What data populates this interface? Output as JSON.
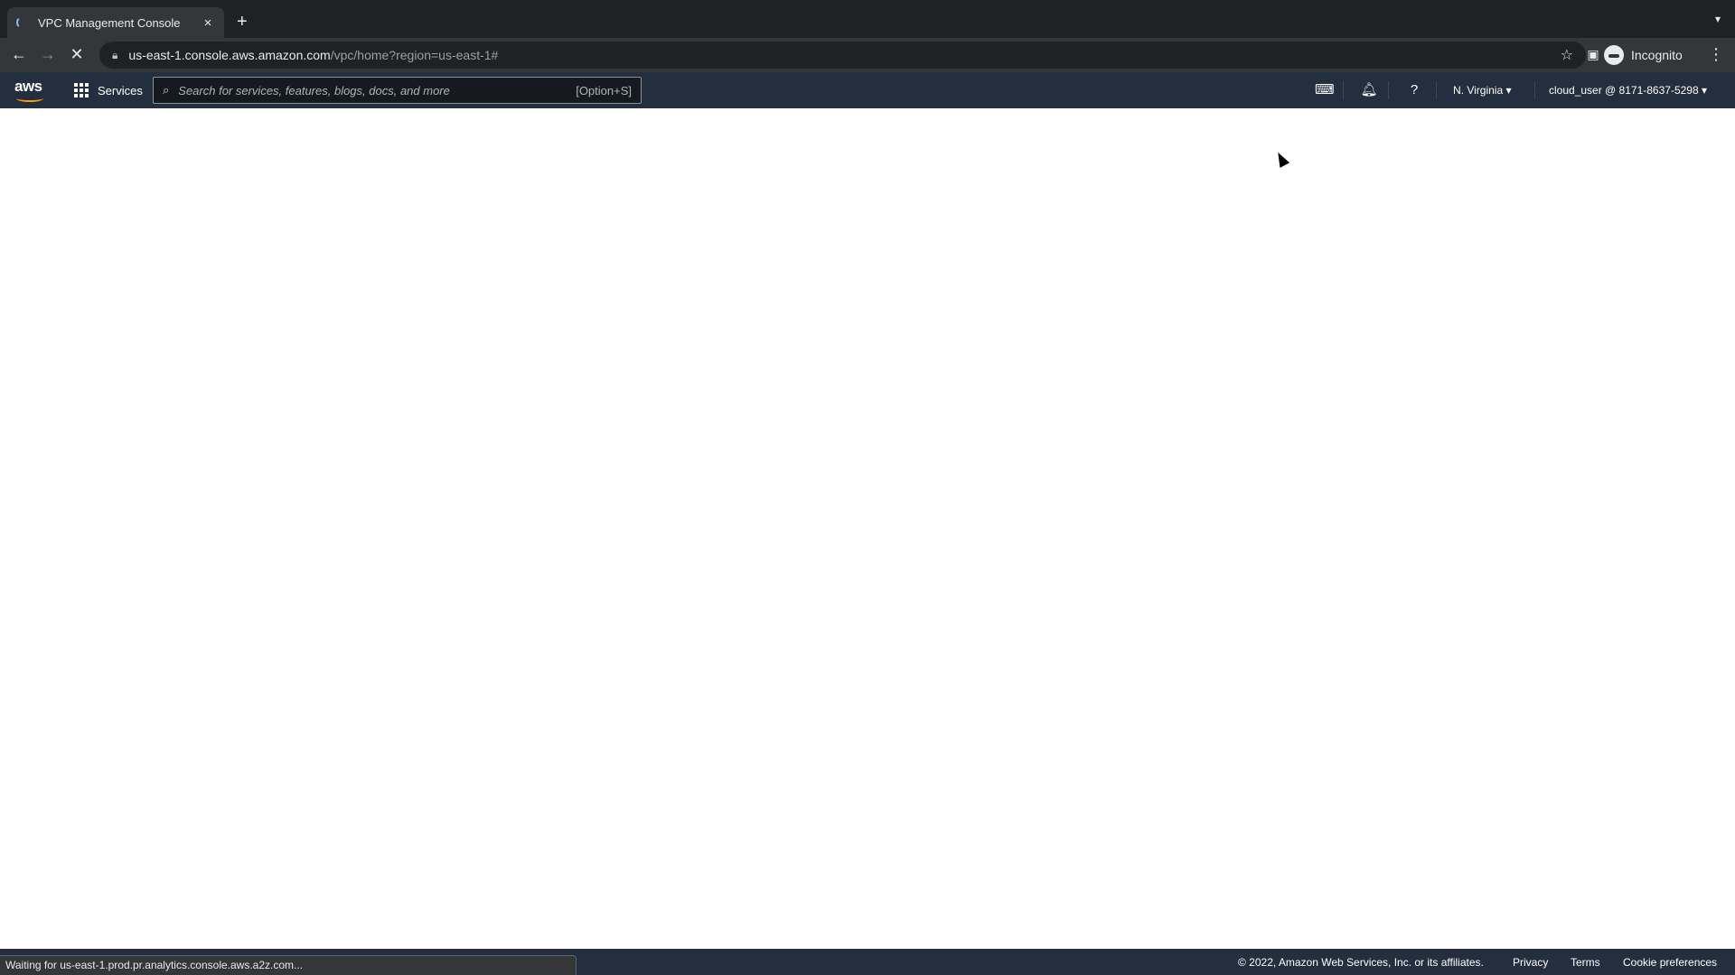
{
  "browser": {
    "tab_title": "VPC Management Console",
    "close_tab_glyph": "×",
    "new_tab_glyph": "+",
    "url_host": "us-east-1.console.aws.amazon.com",
    "url_path": "/vpc/home?region=us-east-1#",
    "profile_label": "Incognito",
    "icons": [
      "back-icon",
      "forward-icon",
      "stop-icon",
      "lock-icon",
      "star-icon",
      "side-panel-icon",
      "incognito-icon",
      "kebab-menu-icon",
      "tab-search-icon"
    ]
  },
  "aws_nav": {
    "logo_text": "aws",
    "services_label": "Services",
    "search_placeholder": "Search for services, features, blogs, docs, and more",
    "search_shortcut": "[Option+S]",
    "region_label": "N. Virginia",
    "account_label": "cloud_user @ 8171-8637-5298",
    "icons": [
      "cloudshell-icon",
      "notifications-bell-icon",
      "help-icon"
    ],
    "colors": {
      "nav_bg": "#232f3e",
      "accent": "#ff9900"
    }
  },
  "footer": {
    "copyright": "© 2022, Amazon Web Services, Inc. or its affiliates.",
    "links": [
      "Privacy",
      "Terms",
      "Cookie preferences"
    ]
  },
  "status_bar": {
    "text": "Waiting for us-east-1.prod.pr.analytics.console.aws.a2z.com..."
  }
}
